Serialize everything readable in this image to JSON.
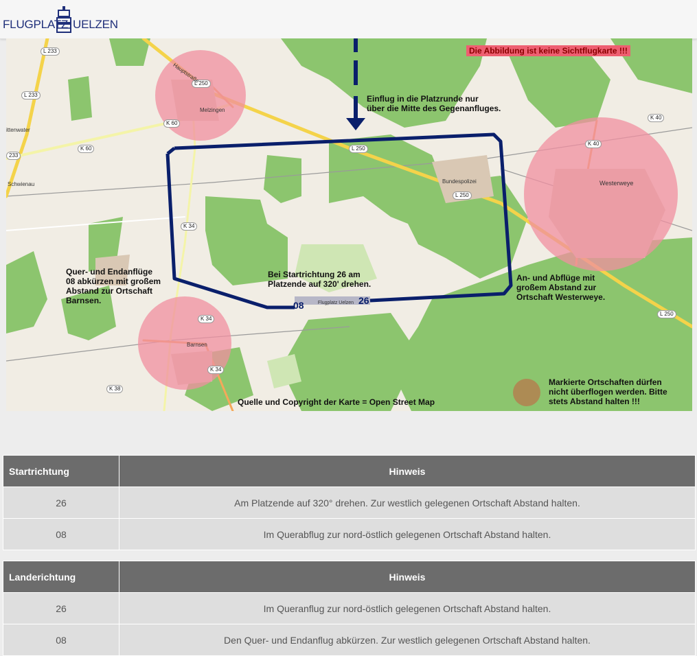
{
  "header": {
    "logo_left": "FLUGPLATZ",
    "logo_right": "UELZEN"
  },
  "map": {
    "warning": "Die Abbildung ist keine Sichtflugkarte !!!",
    "annotations": {
      "entry": "Einflug in die Platzrunde nur\nüber die Mitte des Gegenanfluges.",
      "west": "Quer- und Endanflüge\n08 abkürzen mit großem\nAbstand zur Ortschaft\nBarnsen.",
      "center": "Bei Startrichtung 26 am\nPlatzende auf 320' drehen.",
      "east": "An- und Abflüge mit\ngroßem Abstand zur\nOrtschaft Westerweye.",
      "source": "Quelle und Copyright der Karte = Open Street Map",
      "legend": "Markierte Ortschaften dürfen\nnicht überflogen werden. Bitte\nstets Abstand halten !!!"
    },
    "runway_labels": {
      "west": "08",
      "east": "26"
    },
    "road_tags": [
      "L 233",
      "L 250",
      "L 233",
      "K 60",
      "K 60",
      "L 250",
      "L 250",
      "K 40",
      "K 40",
      "K 34",
      "K 34",
      "K 34",
      "K 38",
      "L 250",
      "233"
    ],
    "places": [
      "Melzingen",
      "Westerweye",
      "Barnsen",
      "Schwienau",
      "ittenwater",
      "Bundespolizei",
      "Flugplatz Uelzen",
      "Hauptstraße"
    ],
    "colors": {
      "circuit": "#0a1f6b",
      "restricted_zone": "#f08fa0",
      "forest": "#8cc56e",
      "warning_bg": "#ee5f71"
    }
  },
  "tables": [
    {
      "headers": [
        "Startrichtung",
        "Hinweis"
      ],
      "rows": [
        [
          "26",
          "Am Platzende auf 320° drehen. Zur westlich gelegenen Ortschaft Abstand halten."
        ],
        [
          "08",
          "Im Querabflug zur nord-östlich gelegenen Ortschaft Abstand halten."
        ]
      ]
    },
    {
      "headers": [
        "Landerichtung",
        "Hinweis"
      ],
      "rows": [
        [
          "26",
          "Im Queranflug zur nord-östlich gelegenen Ortschaft Abstand halten."
        ],
        [
          "08",
          "Den Quer- und Endanflug abkürzen. Zur westlich gelegenen Ortschaft Abstand halten."
        ]
      ]
    }
  ]
}
